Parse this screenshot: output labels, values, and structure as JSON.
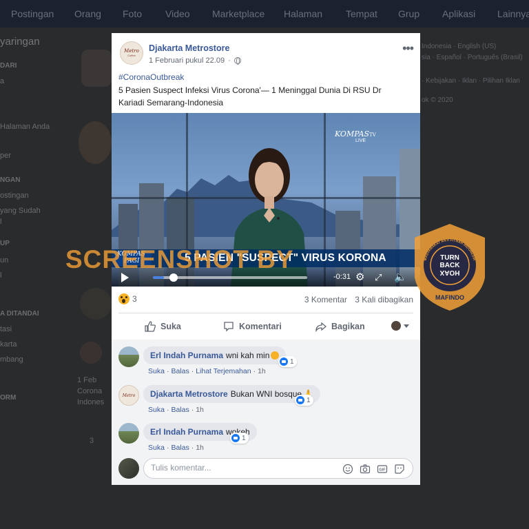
{
  "background_nav": [
    "Postingan",
    "Orang",
    "Foto",
    "Video",
    "Marketplace",
    "Halaman",
    "Tempat",
    "Grup",
    "Aplikasi",
    "Lainnya"
  ],
  "background_left": [
    "yaringan",
    "DARI",
    "a",
    "Halaman Anda",
    "per",
    "NGAN",
    "ostingan",
    "yang Sudah",
    "l",
    "UP",
    "un",
    "l",
    "A DITANDAI",
    "tasi",
    "karta",
    "mbang",
    "ORM"
  ],
  "background_right": [
    "Indonesia · English (US)",
    "sia · Español · Português (Brasil)",
    "· Kebijakan · Iklan · Pilihan Iklan",
    "ok © 2020"
  ],
  "background_post": {
    "date": "1 Feb",
    "line1": "Corona",
    "line2": "Indones",
    "count": "3"
  },
  "post": {
    "page_name": "Djakarta Metrostore",
    "avatar_text_1": "Metro",
    "avatar_text_2": "Coffee",
    "timestamp": "1 Februari pukul 22.09",
    "more_label": "•••",
    "hashtag": "#CoronaOutbreak",
    "text": "5 Pasien Suspect Infeksi Virus Corona'— 1 Meninggal Dunia Di RSU Dr Kariadi Semarang-Indonesia"
  },
  "video": {
    "channel_logo": "KOMPAS",
    "channel_logo_suffix": "TV",
    "live_label": "LIVE",
    "program_logo_1": "KOMPAS",
    "program_logo_2": "PAGI",
    "headline": "5 PASIEN \"SUSPECT\" VIRUS KORONA",
    "time_remaining": "-0:31",
    "progress": 0.07
  },
  "stats": {
    "reaction_count": "3",
    "comments": "3 Komentar",
    "shares": "3 Kali dibagikan"
  },
  "actions": {
    "like": "Suka",
    "comment": "Komentari",
    "share": "Bagikan"
  },
  "comments": [
    {
      "author": "Erl Indah Purnama",
      "text": "wni kah min",
      "likes": "1",
      "like": "Suka",
      "reply": "Balas",
      "translate": "Lihat Terjemahan",
      "time": "1h"
    },
    {
      "author": "Djakarta Metrostore",
      "text": "Bukan WNI bosque",
      "likes": "1",
      "like": "Suka",
      "reply": "Balas",
      "time": "1h"
    },
    {
      "author": "Erl Indah Purnama",
      "text": "wokeh",
      "likes": "1",
      "like": "Suka",
      "reply": "Balas",
      "time": "1h"
    }
  ],
  "composer": {
    "placeholder": "Tulis komentar..."
  },
  "watermark": {
    "text": "SCREENSHOT BY",
    "badge_top": "MASYARAKAT ANTI FITNAH INDONESIA",
    "badge_line1": "TURN",
    "badge_line2": "BACK",
    "badge_line3": "HOAX",
    "badge_bottom": "MAFINDO"
  },
  "colors": {
    "link": "#385898",
    "like_blue": "#1877f2",
    "watermark_orange": "#f2a037",
    "badge_navy": "#1b2a5a"
  }
}
